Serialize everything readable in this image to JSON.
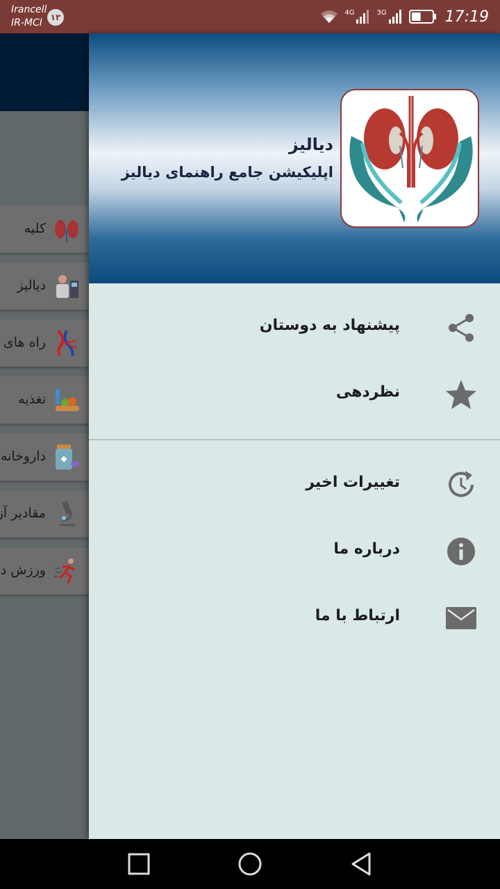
{
  "status_bar": {
    "carrier_line1": "Irancell",
    "carrier_line2": "IR-MCI",
    "notification_count": "۱۳",
    "network_type_1": "4G",
    "network_type_2": "3G",
    "time": "17:19",
    "battery_level": 0.45
  },
  "background_screen": {
    "toolbar_color": "#001a33",
    "items": [
      {
        "label": "کلیه",
        "icon": "kidney-icon"
      },
      {
        "label": "دیالیز",
        "icon": "doctor-icon"
      },
      {
        "label": "راه های",
        "icon": "blood-vessels-icon"
      },
      {
        "label": "تغذیه",
        "icon": "food-icon"
      },
      {
        "label": "داروخانه",
        "icon": "medicine-icon"
      },
      {
        "label": "مقادیر آز",
        "icon": "microscope-icon"
      },
      {
        "label": "ورزش د",
        "icon": "running-icon"
      }
    ]
  },
  "drawer": {
    "header": {
      "app_name": "دیالیز",
      "subtitle": "اپلیکیشن جامع راهنمای دیالیز",
      "logo_icon": "kidney-hands-logo"
    },
    "menu_group_1": [
      {
        "label": "پیشنهاد به دوستان",
        "icon": "share-icon"
      },
      {
        "label": "نظردهی",
        "icon": "star-icon"
      }
    ],
    "menu_group_2": [
      {
        "label": "تغییرات اخیر",
        "icon": "history-icon"
      },
      {
        "label": "درباره ما",
        "icon": "info-icon"
      },
      {
        "label": "ارتباط با ما",
        "icon": "mail-icon"
      }
    ]
  },
  "colors": {
    "status_bar": "#7a3b36",
    "drawer_background": "#dae8e8",
    "icon_gray": "#6b6b6b",
    "header_dark_blue": "#0c4a7c"
  },
  "nav_bar": {
    "buttons": [
      "recent-apps-icon",
      "home-icon",
      "back-icon"
    ]
  }
}
